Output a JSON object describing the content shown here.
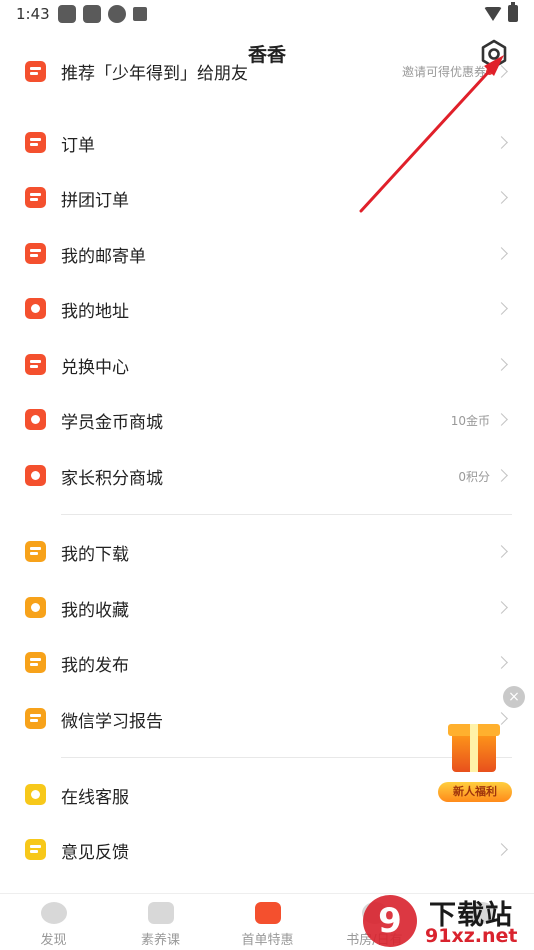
{
  "status_bar": {
    "time": "1:43"
  },
  "header": {
    "title": "香香"
  },
  "menu": [
    {
      "label": "推荐「少年得到」给朋友",
      "extra": "邀请可得优惠券",
      "icon": "gift-icon",
      "color": "#f4502e"
    },
    {
      "label": "订单",
      "extra": "",
      "icon": "order-icon",
      "color": "#f4502e"
    },
    {
      "label": "拼团订单",
      "extra": "",
      "icon": "group-order-icon",
      "color": "#f4502e"
    },
    {
      "label": "我的邮寄单",
      "extra": "",
      "icon": "truck-icon",
      "color": "#f4502e"
    },
    {
      "label": "我的地址",
      "extra": "",
      "icon": "location-icon",
      "color": "#f4502e"
    },
    {
      "label": "兑换中心",
      "extra": "",
      "icon": "checkbox-icon",
      "color": "#f4502e"
    },
    {
      "label": "学员金币商城",
      "extra": "10金币",
      "icon": "coin-icon",
      "color": "#f4502e"
    },
    {
      "label": "家长积分商城",
      "extra": "0积分",
      "icon": "diamond-icon",
      "color": "#f4502e"
    },
    {
      "label": "我的下载",
      "extra": "",
      "icon": "download-icon",
      "color": "#f7a21a"
    },
    {
      "label": "我的收藏",
      "extra": "",
      "icon": "heart-icon",
      "color": "#f7a21a"
    },
    {
      "label": "我的发布",
      "extra": "",
      "icon": "publish-icon",
      "color": "#f7a21a"
    },
    {
      "label": "微信学习报告",
      "extra": "",
      "icon": "report-icon",
      "color": "#f7a21a"
    },
    {
      "label": "在线客服",
      "extra": "",
      "icon": "headset-icon",
      "color": "#f7c81a"
    },
    {
      "label": "意见反馈",
      "extra": "",
      "icon": "feedback-icon",
      "color": "#f7c81a"
    }
  ],
  "promo": {
    "label": "新人福利"
  },
  "tabbar": [
    {
      "label": "发现"
    },
    {
      "label": "素养课"
    },
    {
      "label": "首单特惠"
    },
    {
      "label": "书房/日有"
    },
    {
      "label": ""
    }
  ],
  "watermark": {
    "title": "下载站",
    "url": "91xz.net",
    "logo": "9"
  }
}
